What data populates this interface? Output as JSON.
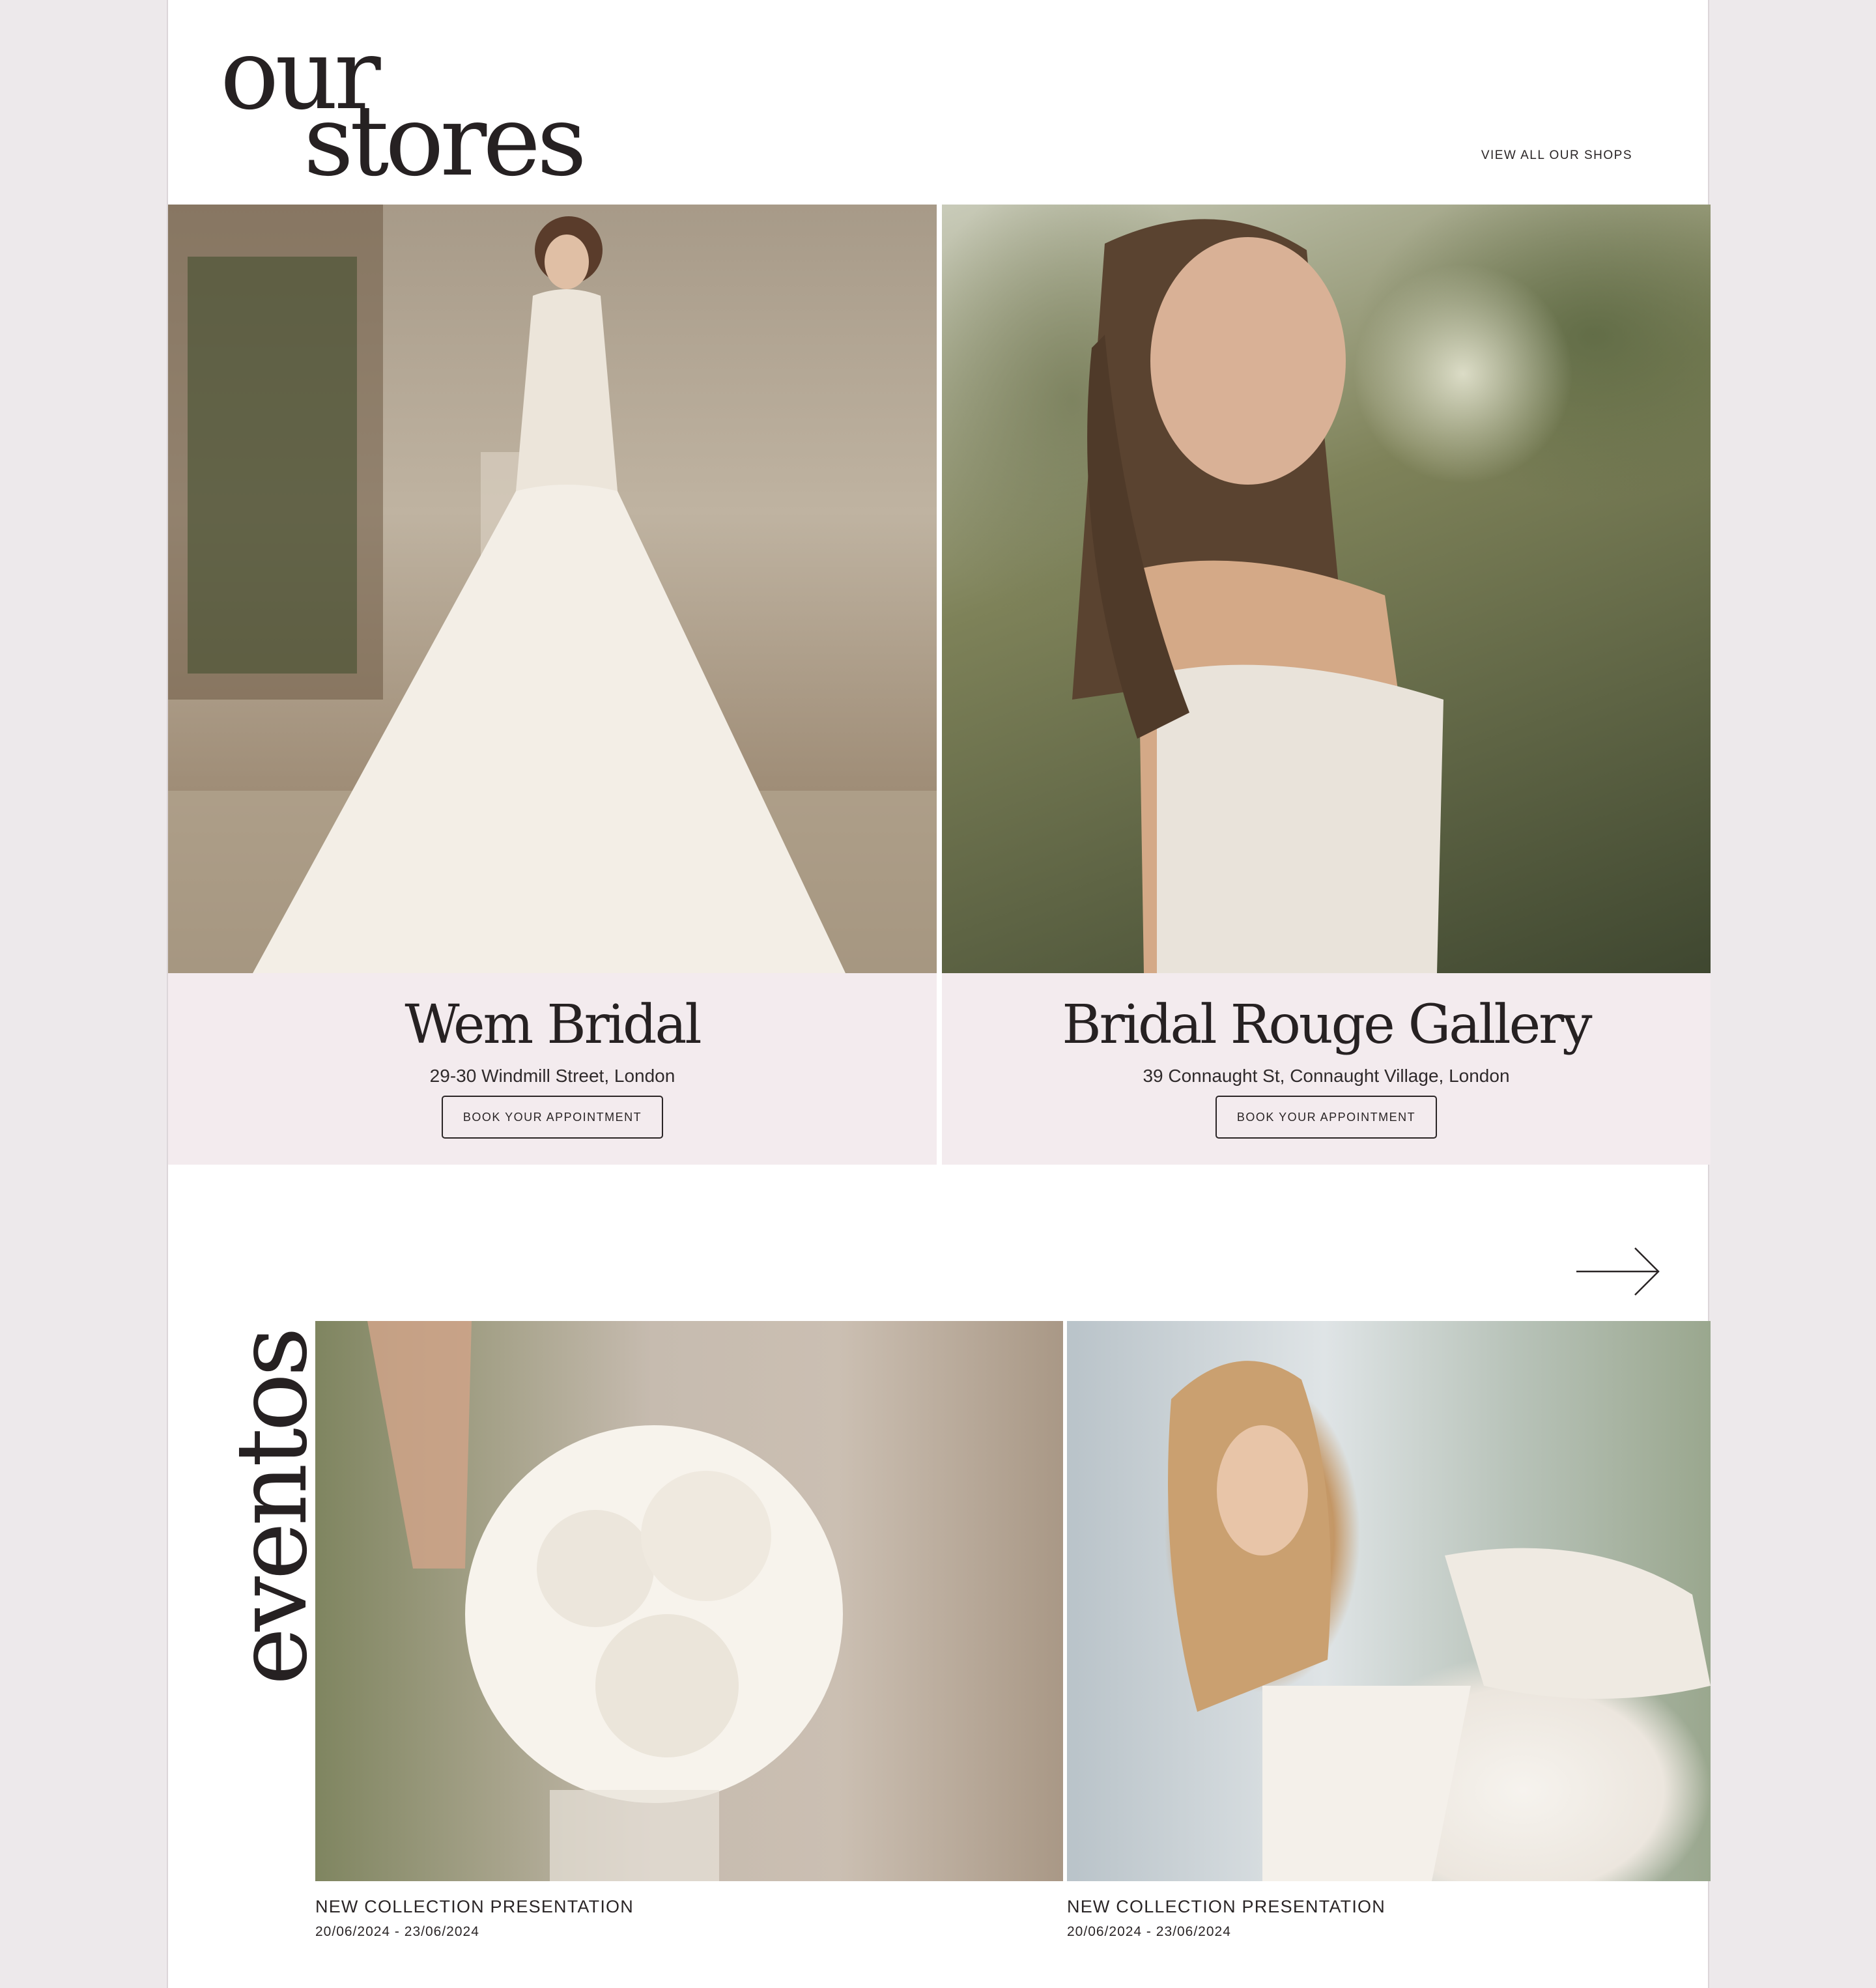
{
  "header": {
    "title_line1": "our",
    "title_line2": "stores",
    "view_all_label": "VIEW ALL OUR SHOPS"
  },
  "stores": [
    {
      "name": "Wem Bridal",
      "address": "29-30 Windmill Street, London",
      "button_label": "BOOK YOUR APPOINTMENT"
    },
    {
      "name": "Bridal Rouge Gallery",
      "address": "39 Connaught St, Connaught Village, London",
      "button_label": "BOOK YOUR APPOINTMENT"
    }
  ],
  "events": {
    "label": "eventos",
    "next_icon": "arrow-right-icon",
    "items": [
      {
        "title": "NEW COLLECTION PRESENTATION",
        "dates": "20/06/2024 - 23/06/2024"
      },
      {
        "title": "NEW COLLECTION PRESENTATION",
        "dates": "20/06/2024 - 23/06/2024"
      }
    ]
  },
  "colors": {
    "page_background": "#ede9eb",
    "card_background": "#f3ebee",
    "text": "#2a2526"
  }
}
